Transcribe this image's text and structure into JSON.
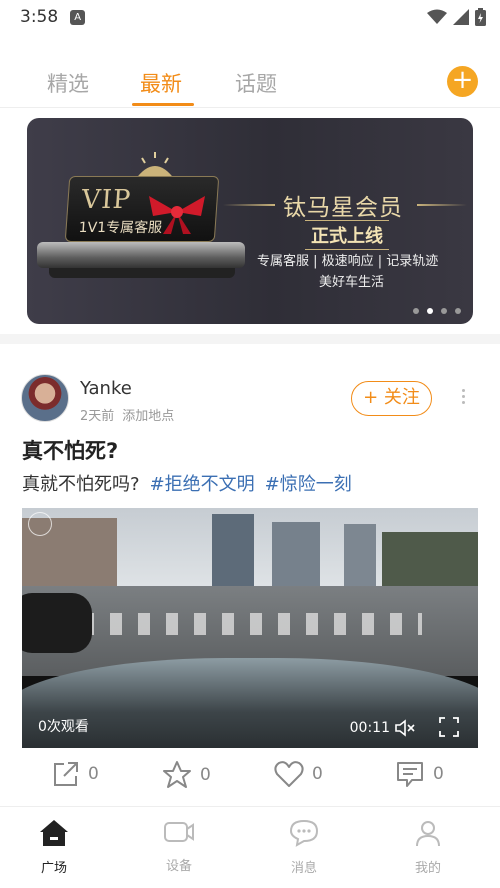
{
  "status_bar": {
    "time": "3:58",
    "app_badge": "A"
  },
  "tabs": [
    {
      "label": "精选",
      "active": false
    },
    {
      "label": "最新",
      "active": true
    },
    {
      "label": "话题",
      "active": false
    }
  ],
  "add_button_icon": "plus-icon",
  "banner": {
    "vip_text": "VIP",
    "vip_sub": "1V1专属客服",
    "title": "钛马星会员",
    "subtitle": "正式上线",
    "features": "专属客服 | 极速响应 | 记录轨迹",
    "tagline": "美好车生活",
    "dot_count": 4,
    "active_dot": 1
  },
  "post": {
    "author": "Yanke",
    "time_ago": "2天前",
    "location": "添加地点",
    "follow_label": "+ 关注",
    "title": "真不怕死?",
    "body": "真就不怕死吗?",
    "hashtags": [
      "#拒绝不文明",
      "#惊险一刻"
    ],
    "video": {
      "views": "0次观看",
      "duration": "00:11"
    },
    "actions": {
      "share": "0",
      "favorite": "0",
      "like": "0",
      "comment": "0"
    }
  },
  "bottom_nav": [
    {
      "label": "广场",
      "icon": "home-icon",
      "active": true
    },
    {
      "label": "设备",
      "icon": "camera-icon",
      "active": false
    },
    {
      "label": "消息",
      "icon": "chat-icon",
      "active": false
    },
    {
      "label": "我的",
      "icon": "user-icon",
      "active": false
    }
  ],
  "colors": {
    "accent": "#f28c18",
    "hashtag": "#3b6fb3"
  }
}
